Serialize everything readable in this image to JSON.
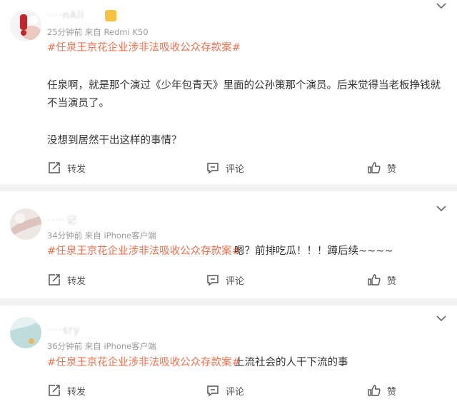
{
  "colors": {
    "hashtag": "#eb7350",
    "meta": "#9a9a9a",
    "separator": "#f2f2f2"
  },
  "icons": {
    "repost": "repost-icon",
    "comment": "comment-icon",
    "like": "like-icon",
    "more": "chevron-down-icon"
  },
  "posts": [
    {
      "username": "····nAll",
      "meta": "25分钟前  来自 Redmi K50",
      "hashtag": "#任泉王京花企业涉非法吸收公众存款案#",
      "body_line1": "任泉啊，就是那个演过《少年包青天》里面的公孙策那个演员。后来觉得当老板挣钱就",
      "body_line2": "不当演员了。",
      "body_line3": "没想到居然干出这样的事情？",
      "repost_label": "转发",
      "comment_label": "评论",
      "like_label": "赞"
    },
    {
      "username": "·····记",
      "meta": "34分钟前  来自 iPhone客户端",
      "hashtag": "#任泉王京花企业涉非法吸收公众存款案#",
      "body": "嗯？前排吃瓜！！！蹲后续~~~~",
      "repost_label": "转发",
      "comment_label": "评论",
      "like_label": "赞"
    },
    {
      "username": "····sry",
      "meta": "36分钟前  来自 iPhone客户端",
      "hashtag": "#任泉王京花企业涉非法吸收公众存款案#",
      "body": "上流社会的人干下流的事",
      "repost_label": "转发",
      "comment_label": "评论",
      "like_label": "赞"
    }
  ]
}
